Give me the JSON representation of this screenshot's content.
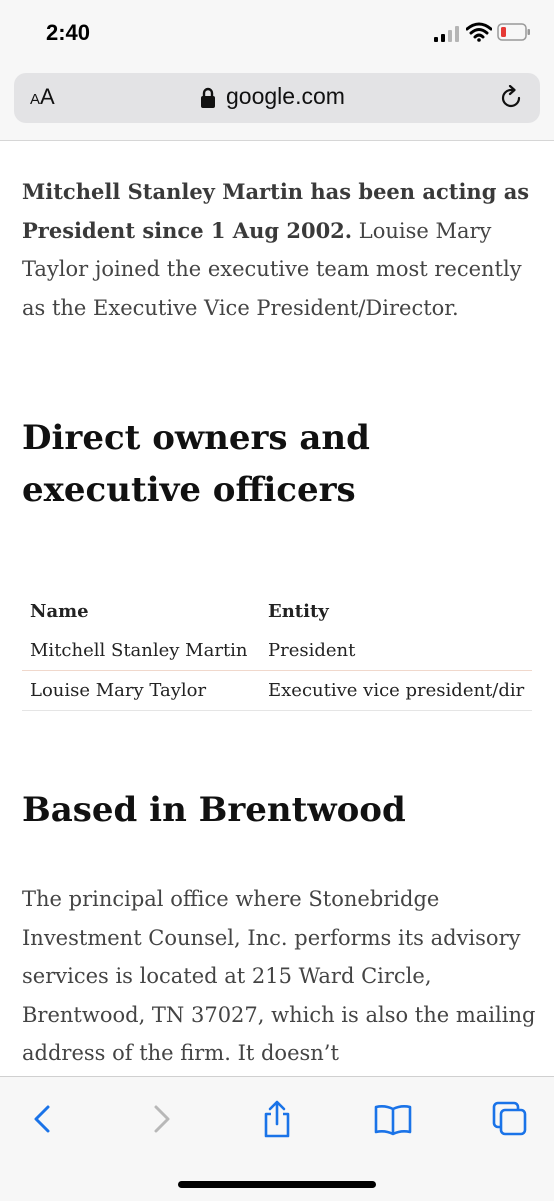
{
  "status": {
    "time": "2:40"
  },
  "browser": {
    "text_size": "AA",
    "domain": "google.com"
  },
  "article": {
    "intro_bold": "Mitchell Stanley Martin has been acting as President since 1 Aug 2002.",
    "intro_rest": " Louise Mary Taylor joined the executive team most recently as the Executive Vice President/Director.",
    "heading_owners": "Direct owners and executive officers",
    "table": {
      "headers": [
        "Name",
        "Entity"
      ],
      "rows": [
        [
          "Mitchell Stanley Martin",
          "President"
        ],
        [
          "Louise Mary Taylor",
          "Executive vice president/dir"
        ]
      ]
    },
    "heading_location": "Based in Brentwood",
    "location_text": "The principal office where Stonebridge Investment Counsel, Inc. performs its advisory services is located at 215 Ward Circle, Brentwood, TN 37027, which is also the mailing address of the firm. It doesn’t"
  },
  "toolbar": {
    "icons": [
      "back-icon",
      "forward-icon",
      "share-icon",
      "bookmarks-icon",
      "tabs-icon"
    ]
  },
  "colors": {
    "accent": "#1a73e8",
    "battery_low": "#e53935"
  }
}
